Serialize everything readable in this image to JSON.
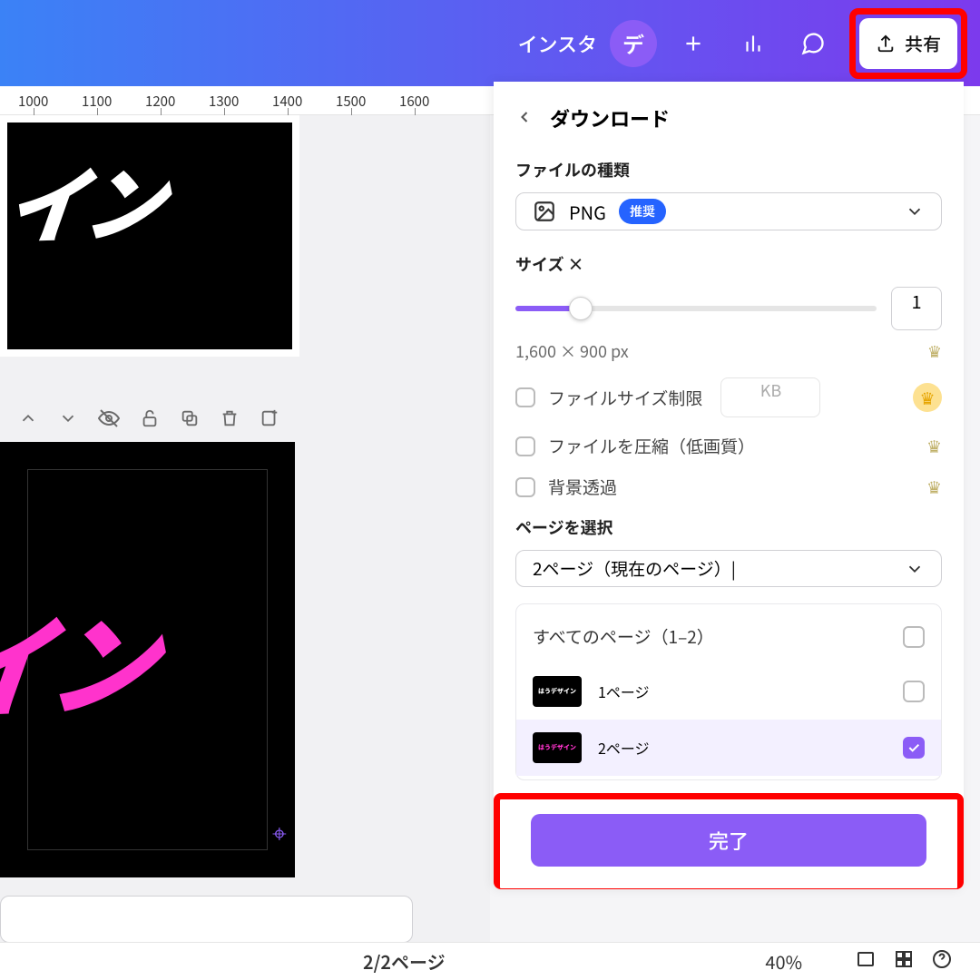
{
  "topbar": {
    "label": "インスタ",
    "avatar_letter": "デ",
    "share": "共有"
  },
  "ruler": [
    "1000",
    "1100",
    "1200",
    "1300",
    "1400",
    "1500",
    "1600"
  ],
  "canvas": {
    "text1": "イン",
    "text2": "イン"
  },
  "panel": {
    "title": "ダウンロード",
    "filetype_label": "ファイルの種類",
    "filetype_value": "PNG",
    "filetype_badge": "推奨",
    "size_label": "サイズ ×",
    "size_value": "1",
    "dimensions": "1,600 × 900 px",
    "limit_label": "ファイルサイズ制限",
    "limit_unit": "KB",
    "compress_label": "ファイルを圧縮（低画質）",
    "transparent_label": "背景透過",
    "pagesel_label": "ページを選択",
    "pagesel_value": "2ページ（現在のページ）|",
    "all_pages": "すべてのページ（1–2）",
    "page1": "1ページ",
    "page2": "2ページ",
    "done": "完了"
  },
  "bottom": {
    "page_indicator": "2/2ページ",
    "zoom": "40%"
  }
}
